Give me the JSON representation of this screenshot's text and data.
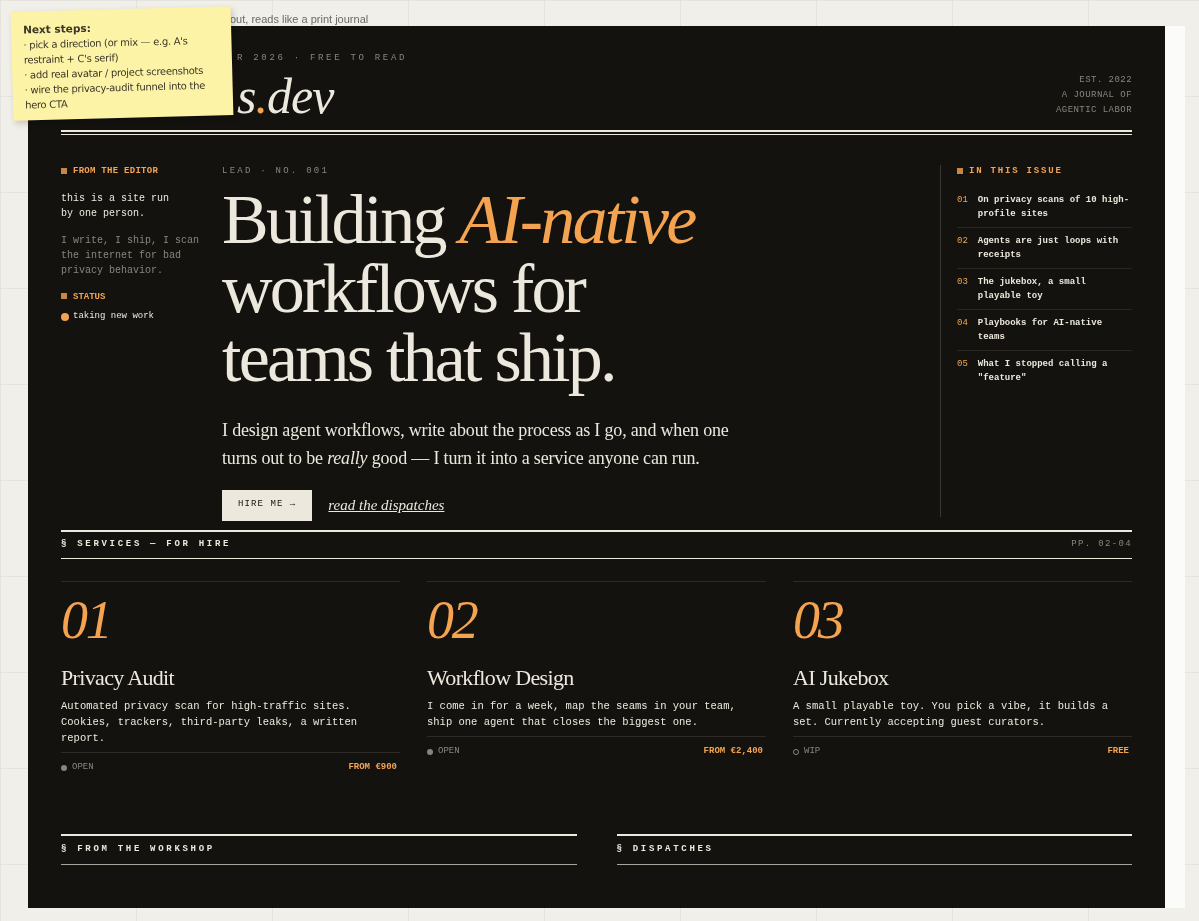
{
  "caption": "out, reads like a print journal",
  "sticky_note": {
    "title": "Next steps:",
    "items": [
      "· pick a direction (or mix — e.g. A's restraint + C's serif)",
      "· add real avatar / project screenshots",
      "· wire the privacy-audit funnel into the hero CTA"
    ]
  },
  "masthead": {
    "meta": "R 2026 · FREE TO READ",
    "logo": {
      "before": "s",
      "dot": ".",
      "after": "dev"
    },
    "tagline": [
      "EST. 2022",
      "A JOURNAL OF",
      "AGENTIC LABOR"
    ]
  },
  "editor": {
    "heading": "FROM THE EDITOR",
    "intro": "this is a site run by one person.",
    "body": "I write, I ship, I scan the internet for bad privacy behavior.",
    "status_heading": "STATUS",
    "status": "taking new work"
  },
  "lead": {
    "kicker": "LEAD · NO. 001",
    "headline": [
      "Building *AI-native*",
      "workflows for",
      "teams that ship."
    ],
    "dek": "I design agent workflows, write about the process as I go, and when one turns out to be *really* good — I turn it into a service anyone can run.",
    "primary_button": "HIRE ME →",
    "secondary_link": "read the dispatches"
  },
  "issue": {
    "heading": "IN THIS ISSUE",
    "items": [
      {
        "number": "01",
        "title": "On privacy scans of 10 high-profile sites"
      },
      {
        "number": "02",
        "title": "Agents are just loops with receipts"
      },
      {
        "number": "03",
        "title": "The jukebox, a small playable toy"
      },
      {
        "number": "04",
        "title": "Playbooks for AI-native teams"
      },
      {
        "number": "05",
        "title": "What I stopped calling a \"feature\""
      }
    ]
  },
  "services": {
    "heading": "§ SERVICES — FOR HIRE",
    "pages": "PP. 02-04",
    "items": [
      {
        "number": "01",
        "title": "Privacy Audit",
        "description": "Automated privacy scan for high-traffic sites. Cookies, trackers, third-party leaks, a written report.",
        "status": "OPEN",
        "active": true,
        "price": "FROM €900"
      },
      {
        "number": "02",
        "title": "Workflow Design",
        "description": "I come in for a week, map the seams in your team, ship one agent that closes the biggest one.",
        "status": "OPEN",
        "active": true,
        "price": "FROM €2,400"
      },
      {
        "number": "03",
        "title": "AI Jukebox",
        "description": "A small playable toy. You pick a vibe, it builds a set. Currently accepting guest curators.",
        "status": "WIP",
        "active": false,
        "price": "FREE"
      }
    ]
  },
  "sections": [
    "§ FROM THE WORKSHOP",
    "§ DISPATCHES"
  ]
}
